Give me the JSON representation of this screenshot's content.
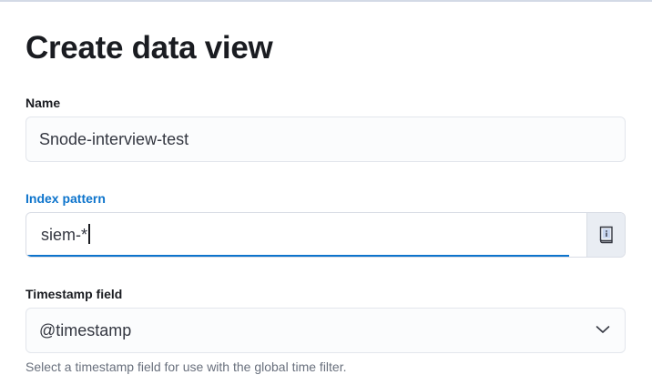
{
  "page": {
    "title": "Create data view"
  },
  "name_field": {
    "label": "Name",
    "value": "Snode-interview-test"
  },
  "index_pattern_field": {
    "label": "Index pattern",
    "value": "siem-*",
    "append_icon": "book-info-icon"
  },
  "timestamp_field": {
    "label": "Timestamp field",
    "value": "@timestamp",
    "help_text": "Select a timestamp field for use with the global time filter.",
    "dropdown_icon": "chevron-down-icon"
  },
  "colors": {
    "accent": "#0d74cc",
    "text": "#1a1c21",
    "subdued": "#69707d",
    "input_bg": "#fbfcfd"
  }
}
